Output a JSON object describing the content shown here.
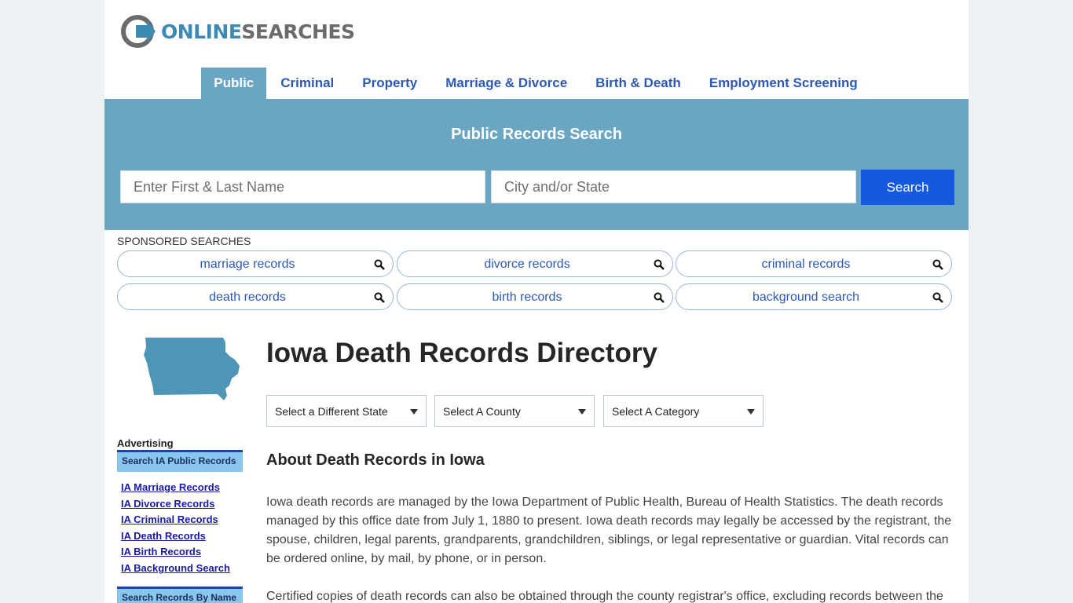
{
  "logo": {
    "part1": "ONLINE",
    "part2": "SEARCHES"
  },
  "nav": {
    "items": [
      "Public",
      "Criminal",
      "Property",
      "Marriage & Divorce",
      "Birth & Death",
      "Employment Screening"
    ]
  },
  "hero": {
    "title": "Public Records Search",
    "name_placeholder": "Enter First & Last Name",
    "location_placeholder": "City and/or State",
    "search_label": "Search"
  },
  "sponsored": {
    "label": "SPONSORED SEARCHES",
    "items": [
      "marriage records",
      "divorce records",
      "criminal records",
      "death records",
      "birth records",
      "background search"
    ]
  },
  "sidebar": {
    "advertising_label": "Advertising",
    "box_title": "Search IA Public Records",
    "links": [
      "IA Marriage Records",
      "IA Divorce Records",
      "IA Criminal Records",
      "IA Death Records",
      "IA Birth Records",
      "IA Background Search"
    ],
    "box2_title": "Search Records By Name"
  },
  "main": {
    "title": "Iowa Death Records Directory",
    "selects": [
      "Select a Different State",
      "Select A County",
      "Select A Category"
    ],
    "about_heading": "About Death Records in Iowa",
    "para1": "Iowa death records are managed by the Iowa Department of Public Health, Bureau of Health Statistics. The death records managed by this office date from July 1, 1880 to present. Iowa death records may legally be accessed by the registrant, the spouse, children, legal parents, grandparents, grandchildren, siblings, or legal representative or guardian. Vital records can be ordered online, by mail, by phone, or in person.",
    "para2": "Certified copies of death records can also be obtained through the county registrar's office, excluding records between the"
  },
  "colors": {
    "accent": "#6aa5c1",
    "button": "#1459e0",
    "link": "#2b59b5",
    "map": "#4f95b5"
  }
}
